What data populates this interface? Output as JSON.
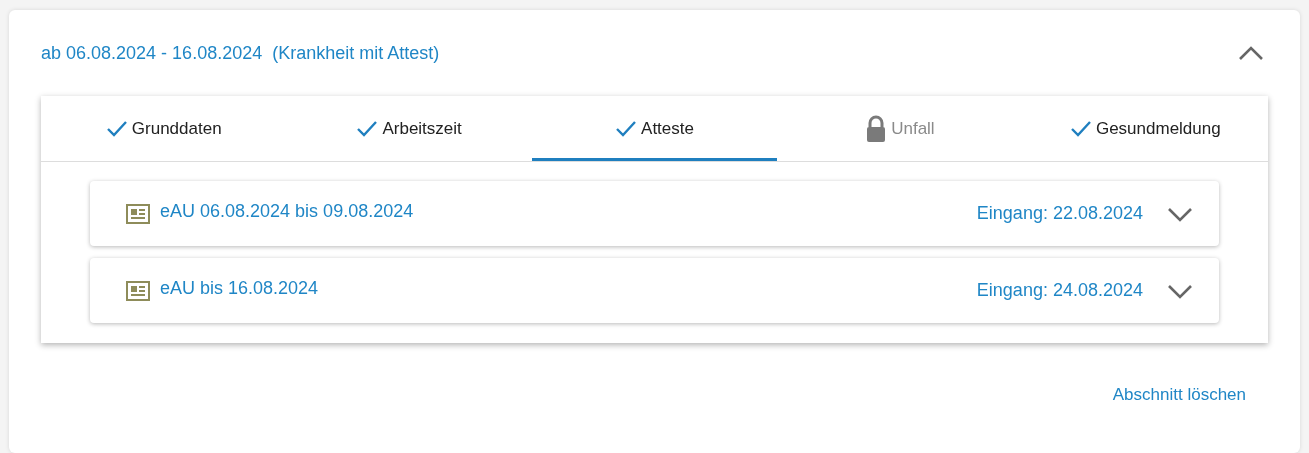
{
  "section": {
    "title": "ab 06.08.2024 - 16.08.2024  (Krankheit mit Attest)",
    "expanded": true
  },
  "tabs": [
    {
      "label": "Grunddaten",
      "kind": "done",
      "selected": false
    },
    {
      "label": "Arbeitszeit",
      "kind": "done",
      "selected": false
    },
    {
      "label": "Atteste",
      "kind": "done",
      "selected": true
    },
    {
      "label": "Unfall",
      "kind": "locked",
      "selected": false
    },
    {
      "label": "Gesundmeldung",
      "kind": "done",
      "selected": false
    }
  ],
  "certificates": [
    {
      "title": "eAU 06.08.2024 bis 09.08.2024",
      "received": "Eingang: 22.08.2024",
      "expanded": false
    },
    {
      "title": "eAU bis 16.08.2024",
      "received": "Eingang: 24.08.2024",
      "expanded": false
    }
  ],
  "delete_link": "Abschnitt löschen"
}
